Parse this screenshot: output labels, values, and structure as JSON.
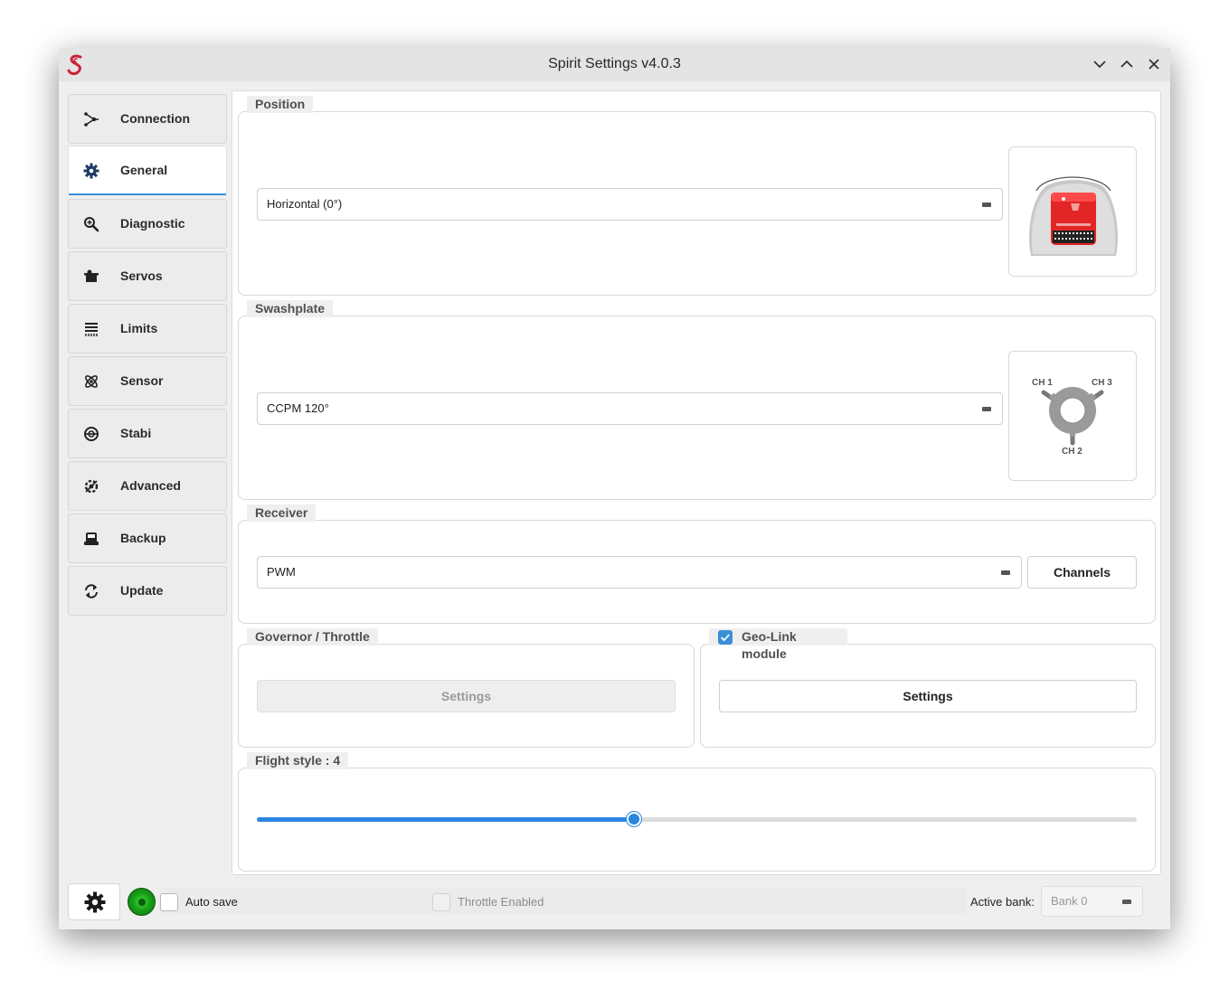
{
  "window": {
    "title": "Spirit Settings v4.0.3"
  },
  "sidebar": {
    "items": [
      {
        "label": "Connection",
        "icon": "connection-icon",
        "active": false
      },
      {
        "label": "General",
        "icon": "gear-icon",
        "active": true
      },
      {
        "label": "Diagnostic",
        "icon": "magnifier-icon",
        "active": false
      },
      {
        "label": "Servos",
        "icon": "servo-icon",
        "active": false
      },
      {
        "label": "Limits",
        "icon": "limits-icon",
        "active": false
      },
      {
        "label": "Sensor",
        "icon": "sensor-icon",
        "active": false
      },
      {
        "label": "Stabi",
        "icon": "stabi-icon",
        "active": false
      },
      {
        "label": "Advanced",
        "icon": "advanced-gear-icon",
        "active": false
      },
      {
        "label": "Backup",
        "icon": "backup-icon",
        "active": false
      },
      {
        "label": "Update",
        "icon": "refresh-icon",
        "active": false
      }
    ]
  },
  "position": {
    "title": "Position",
    "value": "Horizontal (0°)"
  },
  "swashplate": {
    "title": "Swashplate",
    "value": "CCPM 120°",
    "diagram": {
      "ch1": "CH 1",
      "ch2": "CH 2",
      "ch3": "CH 3"
    }
  },
  "receiver": {
    "title": "Receiver",
    "value": "PWM",
    "channels_label": "Channels"
  },
  "governor": {
    "title": "Governor / Throttle",
    "settings_label": "Settings",
    "enabled": false
  },
  "geolink": {
    "title": "Geo-Link module",
    "checked": true,
    "settings_label": "Settings"
  },
  "flight_style": {
    "title": "Flight style : 4",
    "value": 4,
    "min": 1,
    "max": 8
  },
  "status_bar": {
    "connected": true,
    "auto_save_label": "Auto save",
    "auto_save_checked": false,
    "throttle_enabled_label": "Throttle Enabled",
    "active_bank_label": "Active bank:",
    "active_bank_value": "Bank 0"
  },
  "colors": {
    "accent": "#2a86e0",
    "status_led": "#19a119",
    "device_red": "#e02020"
  }
}
